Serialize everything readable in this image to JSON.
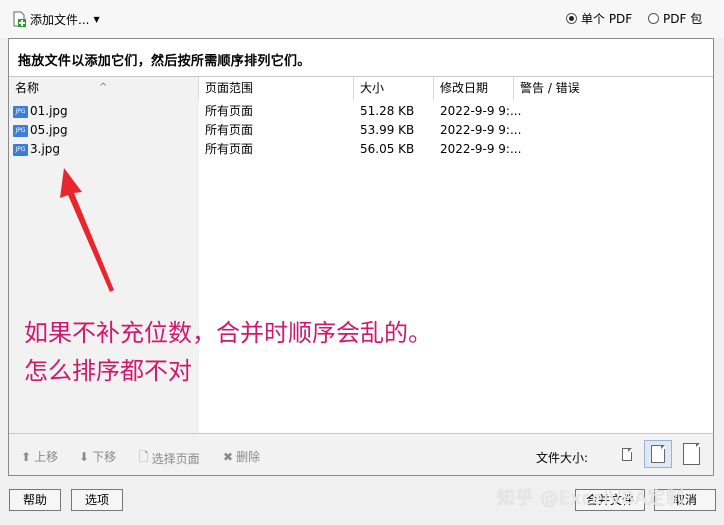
{
  "toolbar": {
    "add_files": "添加文件...",
    "radio_single_pdf": "单个 PDF",
    "radio_pdf_package": "PDF 包",
    "selected": "single_pdf"
  },
  "instruction": "拖放文件以添加它们，然后按所需顺序排列它们。",
  "table": {
    "columns": [
      "名称",
      "页面范围",
      "大小",
      "修改日期",
      "警告 / 错误"
    ],
    "rows": [
      {
        "name": "01.jpg",
        "range": "所有页面",
        "size": "51.28 KB",
        "date": "2022-9-9 9:..."
      },
      {
        "name": "05.jpg",
        "range": "所有页面",
        "size": "53.99 KB",
        "date": "2022-9-9 9:..."
      },
      {
        "name": "3.jpg",
        "range": "所有页面",
        "size": "56.05 KB",
        "date": "2022-9-9 9:..."
      }
    ]
  },
  "annotation": {
    "line1": "如果不补充位数，合并时顺序会乱的。",
    "line2": "怎么排序都不对",
    "color": "#d1196b"
  },
  "bottom": {
    "move_up": "上移",
    "move_down": "下移",
    "select_pages": "选择页面",
    "delete": "删除",
    "file_size_label": "文件大小:"
  },
  "footer": {
    "help": "帮助",
    "options": "选项",
    "combine": "合并文件",
    "cancel": "取消",
    "watermark": "知乎 @ExcelVBA定制"
  },
  "icons": {
    "add_file": "add-file-icon",
    "jpg": "jpg-file-icon",
    "arrow_up": "arrow-up-icon",
    "arrow_down": "arrow-down-icon",
    "page": "page-icon",
    "delete": "x-icon"
  }
}
